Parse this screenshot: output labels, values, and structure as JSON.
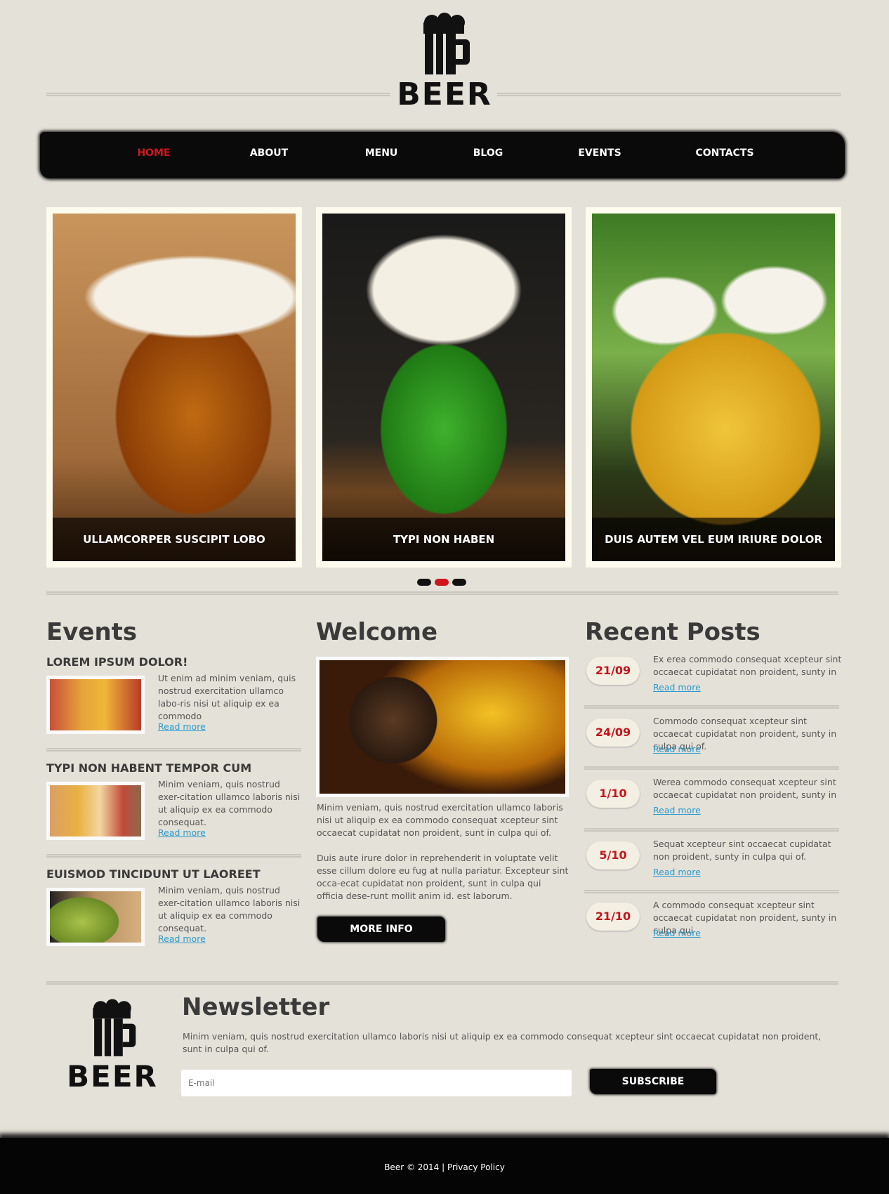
{
  "header": {
    "logo_text": "BEER"
  },
  "nav": {
    "items": [
      {
        "label": "HOME",
        "active": true
      },
      {
        "label": "ABOUT"
      },
      {
        "label": "MENU"
      },
      {
        "label": "BLOG"
      },
      {
        "label": "EVENTS"
      },
      {
        "label": "CONTACTS"
      }
    ]
  },
  "slider": {
    "slides": [
      {
        "caption": "ULLAMCORPER SUSCIPIT LOBO"
      },
      {
        "caption": "TYPI NON HABEN"
      },
      {
        "caption": "DUIS AUTEM VEL EUM IRIURE DOLOR"
      }
    ],
    "active_index": 1
  },
  "events": {
    "heading": "Events",
    "items": [
      {
        "title": "LOREM IPSUM DOLOR!",
        "text": "Ut enim ad minim veniam, quis nostrud exercitation ullamco labo-ris nisi ut aliquip ex ea commodo",
        "link": "Read more"
      },
      {
        "title": "TYPI NON HABENT TEMPOR CUM",
        "text": "Minim veniam, quis nostrud exer-citation ullamco laboris nisi ut aliquip ex ea commodo consequat.",
        "link": "Read more"
      },
      {
        "title": "EUISMOD TINCIDUNT UT LAOREET",
        "text": "Minim veniam, quis nostrud exer-citation ullamco laboris nisi ut aliquip ex ea commodo consequat.",
        "link": "Read more"
      }
    ]
  },
  "welcome": {
    "heading": "Welcome",
    "p1": "Minim veniam, quis nostrud exercitation ullamco laboris nisi ut aliquip ex ea commodo consequat xcepteur sint occaecat cupidatat non proident, sunt in culpa qui of.",
    "p2": "Duis aute irure dolor in reprehenderit in voluptate velit esse cillum dolore eu fug at nulla pariatur.  Excepteur sint occa-ecat cupidatat non proident, sunt in culpa qui officia dese-runt mollit anim id. est laborum.",
    "button": "MORE INFO"
  },
  "recent_posts": {
    "heading": "Recent Posts",
    "items": [
      {
        "date": "21/09",
        "text": "Ex erea commodo consequat xcepteur sint occaecat cupidatat non proident, sunty in",
        "link": "Read more"
      },
      {
        "date": "24/09",
        "text": "Commodo consequat xcepteur sint occaecat cupidatat non proident, sunty in culpa qui of.",
        "link": "Read more"
      },
      {
        "date": "1/10",
        "text": "Werea commodo consequat xcepteur sint occaecat cupidatat non proident, sunty in",
        "link": "Read more"
      },
      {
        "date": "5/10",
        "text": "Sequat xcepteur sint occaecat cupidatat non proident, sunty in culpa qui of.",
        "link": "Read more"
      },
      {
        "date": "21/10",
        "text": "A commodo consequat xcepteur sint occaecat cupidatat non proident, sunty in culpa qui",
        "link": "Read more"
      }
    ]
  },
  "newsletter": {
    "logo_text": "BEER",
    "heading": "Newsletter",
    "text": "Minim veniam, quis nostrud exercitation ullamco laboris nisi ut aliquip ex ea commodo consequat xcepteur sint occaecat cupidatat non proident, sunt in culpa qui of.",
    "email_placeholder": "E-mail",
    "button": "SUBSCRIBE"
  },
  "footer": {
    "copyright": "Beer © 2014",
    "separator": "|",
    "privacy": "Privacy Policy"
  },
  "colors": {
    "accent": "#d0161c",
    "link": "#2a9bd0",
    "background": "#e4e1d8"
  }
}
